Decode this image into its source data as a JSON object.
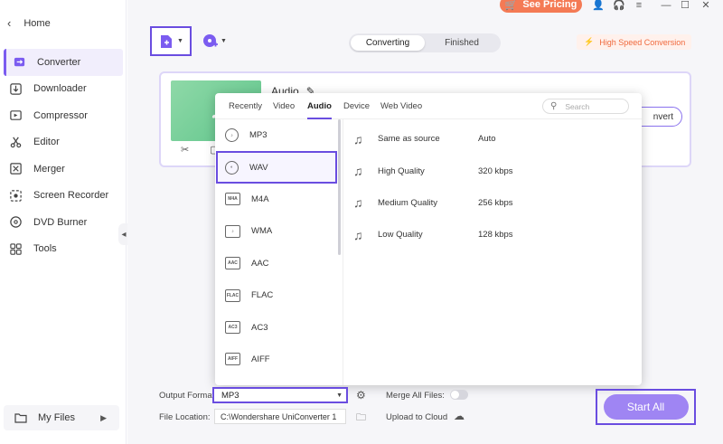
{
  "sidebar": {
    "home_label": "Home",
    "items": [
      {
        "label": "Converter",
        "icon": "converter-icon",
        "active": true
      },
      {
        "label": "Downloader",
        "icon": "downloader-icon"
      },
      {
        "label": "Compressor",
        "icon": "compressor-icon"
      },
      {
        "label": "Editor",
        "icon": "scissors-icon"
      },
      {
        "label": "Merger",
        "icon": "merger-icon"
      },
      {
        "label": "Screen Recorder",
        "icon": "screen-recorder-icon"
      },
      {
        "label": "DVD Burner",
        "icon": "dvd-icon"
      },
      {
        "label": "Tools",
        "icon": "tools-icon"
      }
    ],
    "my_files_label": "My Files"
  },
  "topbar": {
    "see_pricing": "See Pricing",
    "segment": {
      "converting": "Converting",
      "finished": "Finished",
      "active": "Converting"
    },
    "high_speed": "High Speed Conversion"
  },
  "card": {
    "title": "Audio",
    "convert_label": "nvert"
  },
  "format_popup": {
    "tabs": [
      "Recently",
      "Video",
      "Audio",
      "Device",
      "Web Video"
    ],
    "active_tab": "Audio",
    "search_placeholder": "Search",
    "formats": [
      {
        "label": "MP3",
        "icon": "mp3-icon"
      },
      {
        "label": "WAV",
        "icon": "wav-icon",
        "selected": true
      },
      {
        "label": "M4A",
        "icon": "m4a-icon"
      },
      {
        "label": "WMA",
        "icon": "wma-icon"
      },
      {
        "label": "AAC",
        "icon": "aac-icon"
      },
      {
        "label": "FLAC",
        "icon": "flac-icon"
      },
      {
        "label": "AC3",
        "icon": "ac3-icon"
      },
      {
        "label": "AIFF",
        "icon": "aiff-icon"
      }
    ],
    "qualities": [
      {
        "name": "Same as source",
        "value": "Auto"
      },
      {
        "name": "High Quality",
        "value": "320 kbps"
      },
      {
        "name": "Medium Quality",
        "value": "256 kbps"
      },
      {
        "name": "Low Quality",
        "value": "128 kbps"
      }
    ]
  },
  "bottom": {
    "output_format_label": "Output Format:",
    "output_format_value": "MP3",
    "file_location_label": "File Location:",
    "file_location_value": "C:\\Wondershare UniConverter 1",
    "merge_label": "Merge All Files:",
    "merge_on": false,
    "upload_label": "Upload to Cloud",
    "start_all": "Start All"
  },
  "colors": {
    "accent": "#6a4de0",
    "start": "#9f85f3",
    "pricing": "#f47a55"
  }
}
